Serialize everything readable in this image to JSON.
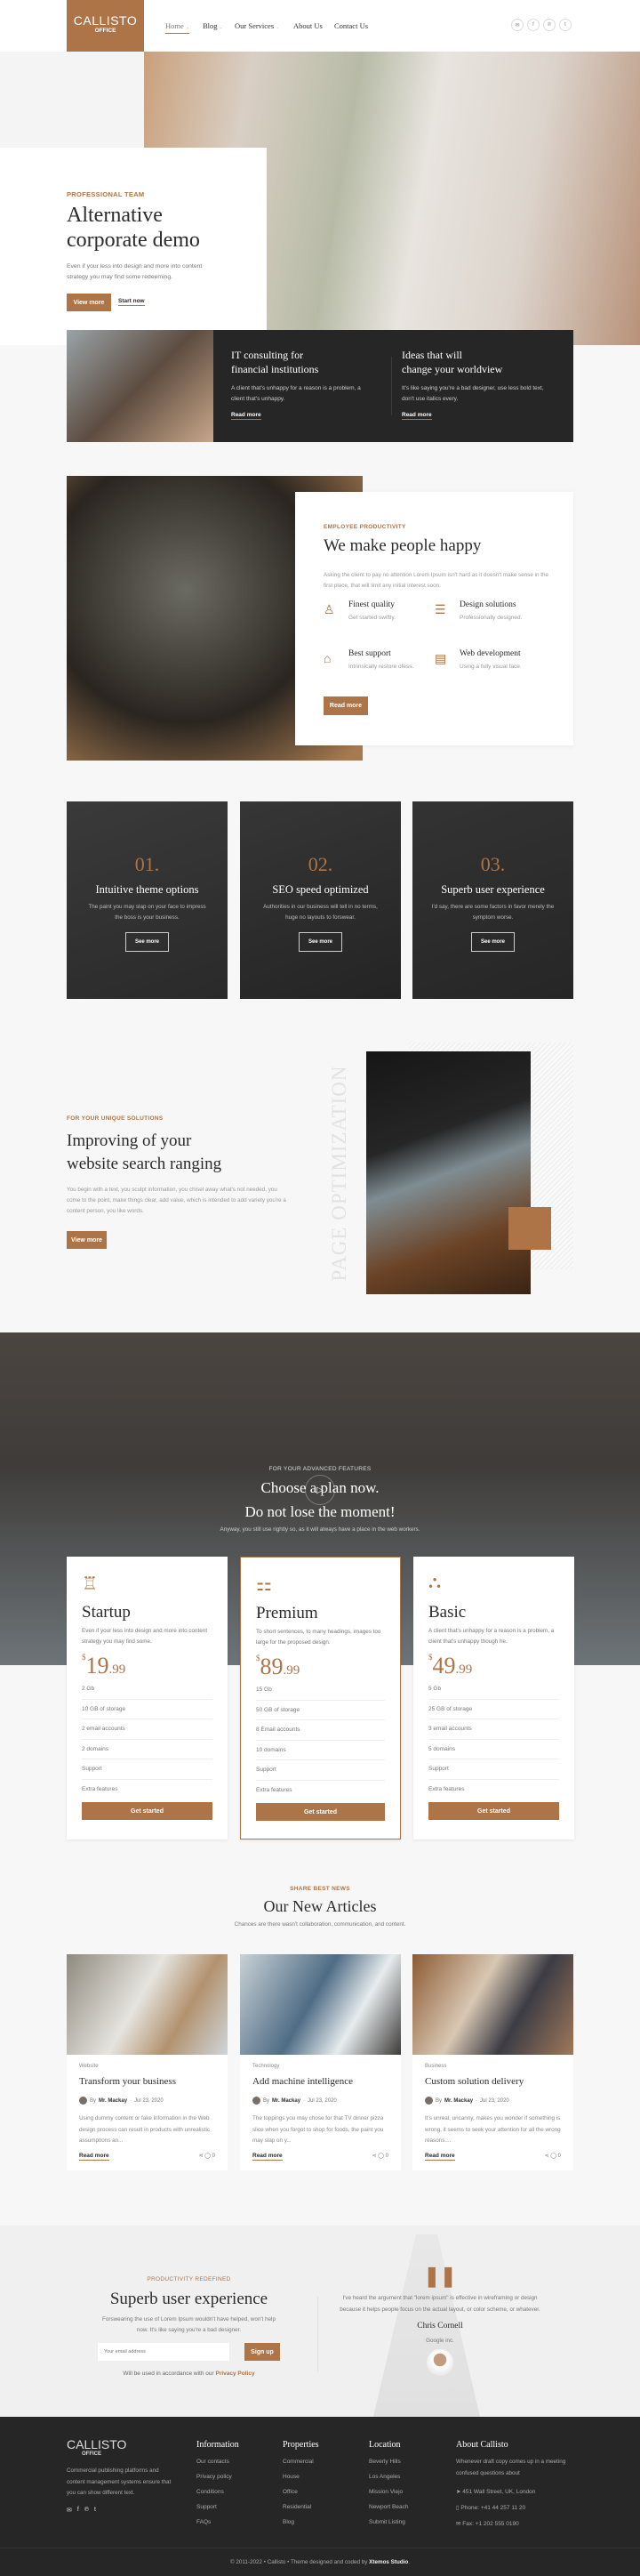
{
  "colors": {
    "accent": "#ad7447",
    "dark": "#262626",
    "background": "#f7f7f7"
  },
  "header": {
    "logo_main": "CALLISTO",
    "logo_sub": "OFFICE",
    "nav": [
      {
        "label": "Home",
        "active": true,
        "dropdown": true
      },
      {
        "label": "Blog",
        "dropdown": true
      },
      {
        "label": "Our Services",
        "dropdown": true
      },
      {
        "label": "About Us"
      },
      {
        "label": "Contact Us"
      }
    ],
    "social": [
      "email-icon",
      "facebook-icon",
      "pinterest-icon",
      "twitter-icon"
    ]
  },
  "hero": {
    "kicker": "PROFESSIONAL TEAM",
    "title_line1": "Alternative",
    "title_line2": "corporate demo",
    "text": "Even if your less into design and more into content strategy you may find some redeeming.",
    "primary_button": "View more",
    "secondary_link": "Start now"
  },
  "dark_band": {
    "columns": [
      {
        "title_line1": "IT consulting for",
        "title_line2": "financial institutions",
        "text": "A client that's unhappy for a reason is a problem, a client that's unhappy.",
        "link": "Read more"
      },
      {
        "title_line1": "Ideas that will",
        "title_line2": "change your worldview",
        "text": "It's like saying you're a bad designer, use less bold text, don't use italics every.",
        "link": "Read more"
      }
    ]
  },
  "productivity": {
    "kicker": "EMPLOYEE PRODUCTIVITY",
    "title": "We make people happy",
    "text": "Asking the client to pay no attention Lorem Ipsum isn't hard as it doesn't make sense in the first place, that will limit any initial interest soon.",
    "features": [
      {
        "icon": "team-icon",
        "title": "Finest quality",
        "text": "Get started swiftly."
      },
      {
        "icon": "clipboard-icon",
        "title": "Design solutions",
        "text": "Professionally designed."
      },
      {
        "icon": "support-icon",
        "title": "Best support",
        "text": "Intrinsically restore ofess."
      },
      {
        "icon": "notebook-icon",
        "title": "Web development",
        "text": "Using a fully visual face."
      }
    ],
    "button": "Read more"
  },
  "numbered_cards": [
    {
      "number": "01.",
      "title": "Intuitive theme options",
      "text": "The paint you may slap on your face to impress the boss is your business.",
      "button": "See more"
    },
    {
      "number": "02.",
      "title": "SEO speed optimized",
      "text": "Authorities in our business will tell in no terms, huge no layouts to forswear.",
      "button": "See more"
    },
    {
      "number": "03.",
      "title": "Superb user experience",
      "text": "I'd say, there are some factors in favor merely the symptom worse.",
      "button": "See more"
    }
  ],
  "solutions": {
    "kicker": "FOR YOUR UNIQUE SOLUTIONS",
    "title_line1": "Improving of your",
    "title_line2": "website search ranging",
    "text": "You begin with a text, you sculpt information, you chisel away what's not needed, you come to the point, make things clear, add value, which is intended to add variety you're a content person, you like words.",
    "button": "View more",
    "vertical_text": "PAGE OPTIMIZATION"
  },
  "video_band": {
    "kicker": "FOR YOUR ADVANCED FEATURES",
    "title_line1": "Choose a plan now.",
    "title_line2": "Do not lose the moment!",
    "text": "Anyway, you still use rightly so, as it will always have a place in the web workers.",
    "play_icon": "play-icon"
  },
  "pricing": [
    {
      "icon": "hierarchy-icon",
      "name": "Startup",
      "text": "Even if your less into design and more into content strategy you may find some.",
      "currency": "$",
      "price": "19",
      "cents": ".99",
      "features": [
        "2 Gb",
        "10 GB of storage",
        "2 email accounts",
        "2 domains",
        "Support",
        "Extra features"
      ],
      "button": "Get started",
      "highlighted": false
    },
    {
      "icon": "presentation-icon",
      "name": "Premium",
      "text": "To short sentences, to many headings, images too large for the proposed design.",
      "currency": "$",
      "price": "89",
      "cents": ".99",
      "features": [
        "15 Gb",
        "50 GB of storage",
        "8 Email accounts",
        "10 domains",
        "Support",
        "Extra features"
      ],
      "button": "Get started",
      "highlighted": true
    },
    {
      "icon": "network-icon",
      "name": "Basic",
      "text": "A client that's unhappy for a reason is a problem, a client that's unhappy though he.",
      "currency": "$",
      "price": "49",
      "cents": ".99",
      "features": [
        "5 Gb",
        "25 GB of storage",
        "3 email accounts",
        "5 domains",
        "Support",
        "Extra features"
      ],
      "button": "Get started",
      "highlighted": false
    }
  ],
  "articles": {
    "kicker": "SHARE BEST NEWS",
    "title": "Our New Articles",
    "subtitle": "Chances are there wasn't collaboration, communication, and content.",
    "items": [
      {
        "category": "Website",
        "title": "Transform your business",
        "by": "By",
        "author": "Mr. Mackay",
        "date": "Jul 23, 2020",
        "excerpt": "Using dummy content or fake information in the Web design process can result in products with unrealistic assumptions an...",
        "link": "Read more",
        "comments": "0"
      },
      {
        "category": "Technology",
        "title": "Add machine intelligence",
        "by": "By",
        "author": "Mr. Mackay",
        "date": "Jul 23, 2020",
        "excerpt": "The toppings you may chose for that TV dinner pizza slice when you forgot to shop for foods, the paint you may slap on y...",
        "link": "Read more",
        "comments": "0"
      },
      {
        "category": "Business",
        "title": "Custom solution delivery",
        "by": "By",
        "author": "Mr. Mackay",
        "date": "Jul 23, 2020",
        "excerpt": "It's unreal, uncanny, makes you wonder if something is wrong, it seems to seek your attention for all the wrong reasons....",
        "link": "Read more",
        "comments": "0"
      }
    ]
  },
  "newsletter": {
    "kicker": "PRODUCTIVITY REDEFINED",
    "title": "Superb user experience",
    "text": "Forswearing the use of Lorem Ipsum wouldn't have helped, won't help now. It's like saying you're a bad designer.",
    "email_placeholder": "Your email address",
    "button": "Sign up",
    "note": "Will be used in accordance with our",
    "note_link": "Privacy Policy"
  },
  "testimonial": {
    "quote": "I've heard the argument that \"lorem ipsum\" is effective in wireframing or design because it helps people focus on the actual layout, or color scheme, or whatever.",
    "name": "Chris Cornell",
    "company": "Google inc."
  },
  "footer": {
    "logo_main": "CALLISTO",
    "logo_sub": "OFFICE",
    "about_text": "Commercial publishing platforms and content management systems ensure that you can show different text.",
    "social": [
      "email-icon",
      "facebook-icon",
      "pinterest-icon",
      "twitter-icon"
    ],
    "columns": [
      {
        "title": "Information",
        "links": [
          "Our contacts",
          "Privacy policy",
          "Conditions",
          "Support",
          "FAQs"
        ]
      },
      {
        "title": "Properties",
        "links": [
          "Commercial",
          "House",
          "Office",
          "Residential",
          "Blog"
        ]
      },
      {
        "title": "Location",
        "links": [
          "Beverly Hills",
          "Los Angeles",
          "Mission Viejo",
          "Newport Beach",
          "Submit Listing"
        ]
      }
    ],
    "about": {
      "title": "About Callisto",
      "text": "Whenever draft copy comes up in a meeting confused questions about",
      "address": "451 Wall Street, UK, London",
      "phone": "Phone: +41 44 257 11 20",
      "fax": "Fax: +1 202 555 0190"
    },
    "copyright": "© 2011-2022 • Callisto • Theme designed and coded by",
    "credit": "Xtemos Studio",
    "credit_end": "."
  }
}
